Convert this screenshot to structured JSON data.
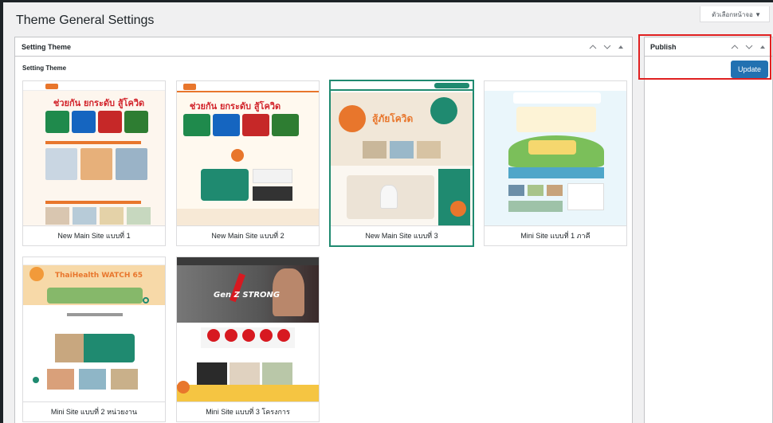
{
  "page": {
    "title": "Theme General Settings"
  },
  "screen_options": {
    "label": "ตัวเลือกหน้าจอ ▼"
  },
  "setting_box": {
    "header": "Setting Theme",
    "inner_title": "Setting Theme",
    "themes": [
      {
        "label": "New Main Site แบบที่ 1",
        "selected": false,
        "accent": "#e8762c"
      },
      {
        "label": "New Main Site แบบที่ 2",
        "selected": false,
        "accent": "#e8762c"
      },
      {
        "label": "New Main Site แบบที่ 3",
        "selected": true,
        "accent": "#1f8a70"
      },
      {
        "label": "Mini Site แบบที่ 1 ภาคี",
        "selected": false,
        "accent": "#7bbf5a"
      },
      {
        "label": "Mini Site แบบที่ 2 หน่วยงาน",
        "selected": false,
        "accent": "#f29a3a"
      },
      {
        "label": "Mini Site แบบที่ 3 โครงการ",
        "selected": false,
        "accent": "#d71920"
      }
    ],
    "thumb_text": {
      "t1_headline": "ช่วยกัน ยกระดับ สู้โควิด",
      "t2_headline": "ช่วยกัน ยกระดับ สู้โควิด",
      "t3_headline": "สู้ภัยโควิด",
      "t5_headline": "ThaiHealth WATCH 65",
      "t6_headline": "Gen Z STRONG"
    }
  },
  "publish_box": {
    "header": "Publish",
    "update_label": "Update"
  },
  "colors": {
    "primary_button": "#2271b1",
    "highlight": "#e02020",
    "selected_border": "#1f8a70"
  }
}
